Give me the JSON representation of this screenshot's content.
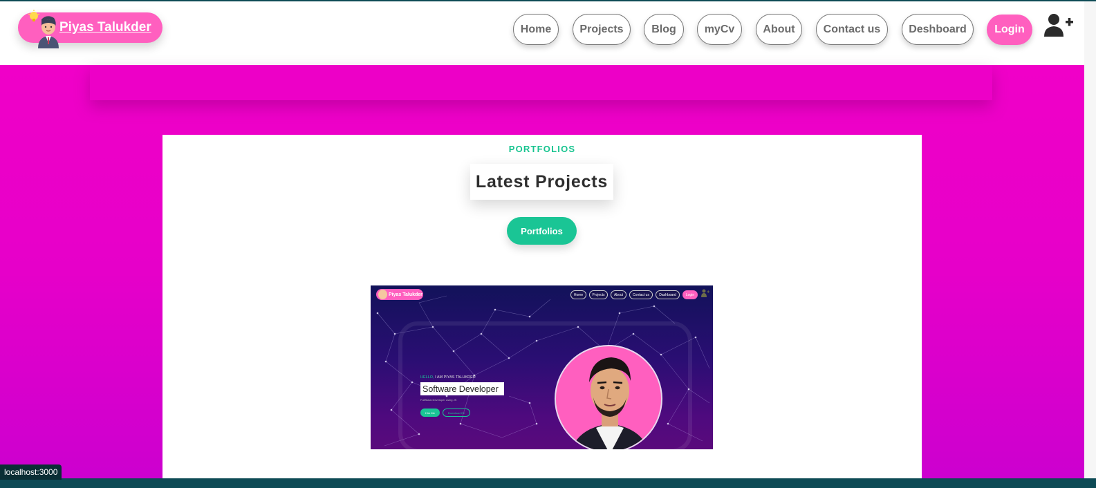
{
  "brand": {
    "name": "Piyas Talukder"
  },
  "nav": {
    "items": [
      {
        "label": "Home"
      },
      {
        "label": "Projects"
      },
      {
        "label": "Blog"
      },
      {
        "label": "myCv"
      },
      {
        "label": "About"
      },
      {
        "label": "Contact us"
      },
      {
        "label": "Deshboard"
      }
    ],
    "login_label": "Login"
  },
  "section": {
    "eyebrow": "PORTFOLIOS",
    "title": "Latest Projects",
    "button_label": "Portfolios"
  },
  "preview": {
    "brand_name": "Piyas Talukder",
    "nav": [
      "Home",
      "Projects",
      "About",
      "Contact us",
      "Dashboard"
    ],
    "login_label": "Login",
    "hello": "HELLO,",
    "intro": "I AM PIYAS TALUKDER",
    "role": "Software Developer",
    "subtitle": "FullStack Developer using JS",
    "hire_label": "Hire Me",
    "download_label": "Download CV"
  },
  "status_bar": {
    "url": "localhost:3000"
  },
  "colors": {
    "accent_pink": "#ff5fbf",
    "accent_green": "#1ac595",
    "background_magenta": "#e600c9"
  },
  "icons": [
    "avatar-icon",
    "user-plus-icon"
  ]
}
